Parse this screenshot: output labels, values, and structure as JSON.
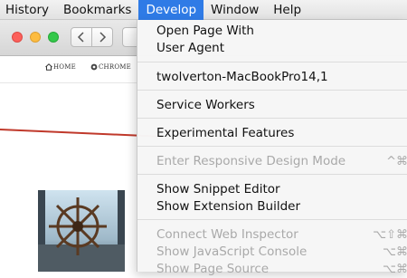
{
  "menubar": {
    "items": [
      "History",
      "Bookmarks",
      "Develop",
      "Window",
      "Help"
    ],
    "active": "Develop"
  },
  "site_nav": {
    "home": "HOME",
    "chrome": "CHROME"
  },
  "develop_menu": {
    "open_page_with": "Open Page With",
    "user_agent": "User Agent",
    "device_name": "twolverton-MacBookPro14,1",
    "service_workers": "Service Workers",
    "experimental_features": "Experimental Features",
    "responsive_design_mode": "Enter Responsive Design Mode",
    "responsive_design_shortcut": "^⌘",
    "snippet_editor": "Show Snippet Editor",
    "extension_builder": "Show Extension Builder",
    "web_inspector": "Connect Web Inspector",
    "web_inspector_shortcut": "⌥⇧⌘",
    "javascript_console": "Show JavaScript Console",
    "javascript_console_shortcut": "⌥⌘",
    "page_source": "Show Page Source",
    "page_source_shortcut": "⌥⌘"
  },
  "colors": {
    "menu_highlight": "#2f7be6",
    "disabled_text": "#a9a9a9",
    "accent_line": "#c0392b"
  },
  "icons": [
    "chevron-left-icon",
    "chevron-right-icon",
    "home-icon",
    "chrome-icon",
    "ship-wheel-photo"
  ]
}
